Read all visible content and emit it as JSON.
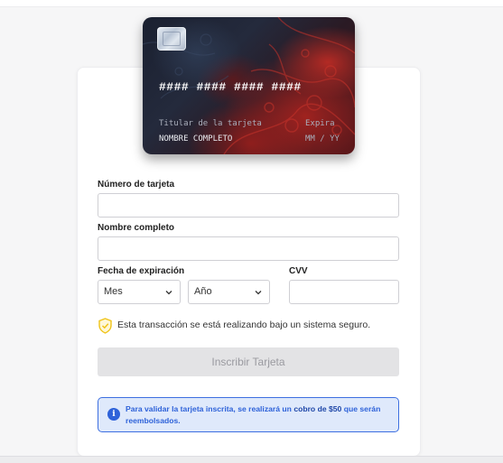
{
  "card_preview": {
    "number_mask": "#### #### #### ####",
    "holder_label": "Titular de la tarjeta",
    "holder_value": "NOMBRE COMPLETO",
    "expiry_label": "Expira",
    "expiry_value": "MM / YY"
  },
  "form": {
    "card_number_label": "Número de tarjeta",
    "card_number_value": "",
    "full_name_label": "Nombre completo",
    "full_name_value": "",
    "expiry_label": "Fecha de expiración",
    "month_select": "Mes",
    "year_select": "Año",
    "cvv_label": "CVV",
    "cvv_value": ""
  },
  "secure_notice": "Esta transacción se está realizando bajo un sistema seguro.",
  "submit_label": "Inscribir Tarjeta",
  "info": {
    "text_before": "Para validar la tarjeta inscrita, se realizará un ",
    "text_bold": "cobro de $50",
    "text_after": " que serán reembolsados."
  },
  "colors": {
    "accent_blue": "#2e62d9",
    "info_bg": "#dfe9fb",
    "shield_yellow": "#f0c419",
    "button_disabled": "#e3e3e5"
  },
  "icons": {
    "secure": "shield-check-icon",
    "info": "info-circle-icon",
    "select_arrow": "chevron-down-icon"
  }
}
